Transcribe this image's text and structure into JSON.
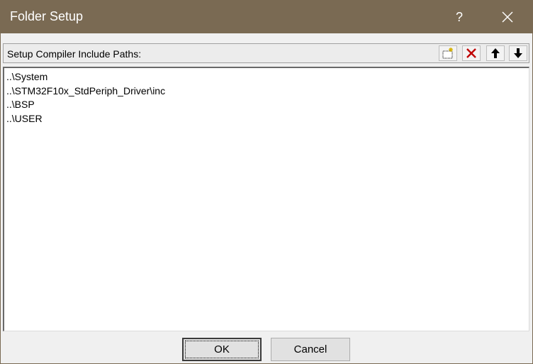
{
  "window": {
    "title": "Folder Setup",
    "help_label": "?",
    "titlebar_color": "#7a6a53"
  },
  "header": {
    "label": "Setup Compiler Include Paths:",
    "tools": [
      {
        "name": "new-folder-icon"
      },
      {
        "name": "delete-icon"
      },
      {
        "name": "move-up-icon"
      },
      {
        "name": "move-down-icon"
      }
    ]
  },
  "paths": [
    "..\\System",
    "..\\STM32F10x_StdPeriph_Driver\\inc",
    "..\\BSP",
    "..\\USER"
  ],
  "buttons": {
    "ok_label": "OK",
    "cancel_label": "Cancel"
  }
}
